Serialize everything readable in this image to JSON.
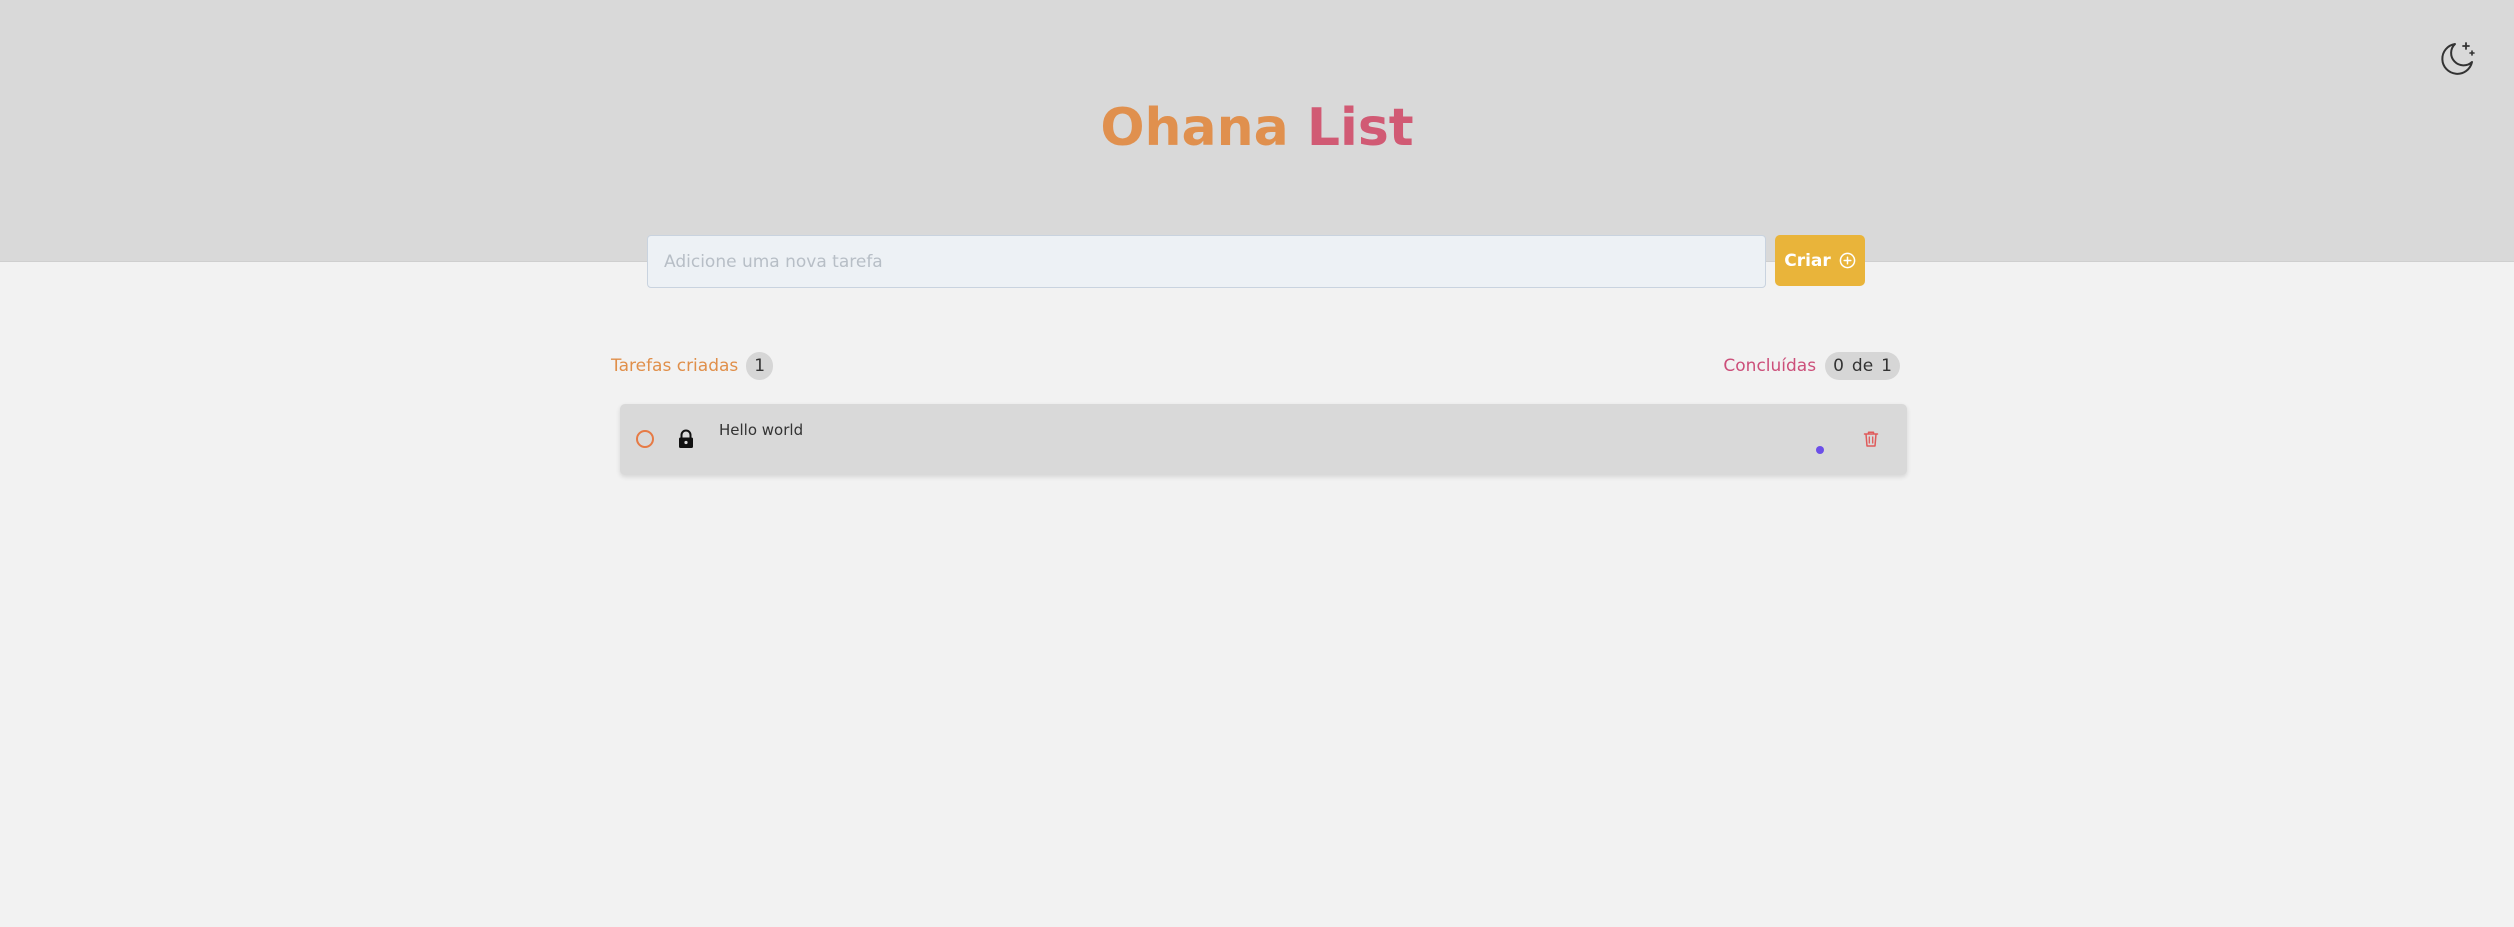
{
  "app": {
    "title_part1": "Ohana",
    "title_part2": "List"
  },
  "header": {
    "theme_toggle_icon": "moon-stars-icon"
  },
  "new_task": {
    "placeholder": "Adicione uma nova tarefa",
    "value": "",
    "create_label": "Criar",
    "create_icon": "plus-circle-icon"
  },
  "stats": {
    "created_label": "Tarefas criadas",
    "created_count": "1",
    "done_label": "Concluídas",
    "done_count": "0",
    "done_of": "de",
    "done_total": "1"
  },
  "tasks": [
    {
      "text": "Hello world",
      "completed": false,
      "locked": true,
      "lock_icon": "lock-icon",
      "delete_icon": "trash-icon",
      "indicator_color": "#6c4fe8"
    }
  ],
  "colors": {
    "title_orange": "#e0904e",
    "title_pink": "#d15a74",
    "create_button": "#e9b43a",
    "created_label": "#e08f4a",
    "done_label": "#cc4f7a",
    "delete_icon": "#e05a5a"
  }
}
